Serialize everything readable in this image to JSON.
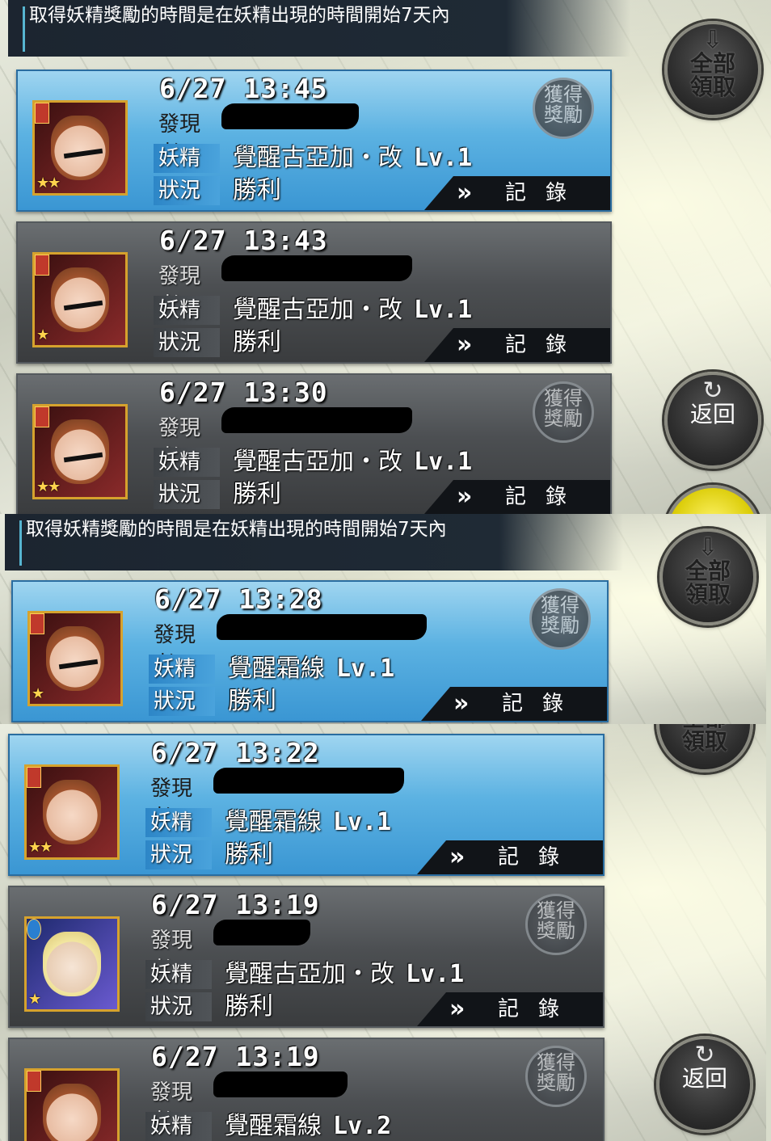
{
  "notice": "取得妖精獎勵的時間是在妖精出現的時間開始7天內",
  "buttons": {
    "claim_all": "全部\n領取",
    "claim_all_l1": "全部",
    "claim_all_l2": "領取",
    "back": "返回"
  },
  "labels": {
    "discoverer": "發現者",
    "fairy": "妖精",
    "status": "狀況",
    "reward_l1": "獲得",
    "reward_l2": "獎勵",
    "record": "記錄",
    "record_chevron": "»"
  },
  "cards": [
    {
      "time": "6/27 13:45",
      "fairy": "覺醒古亞加・改",
      "level": "Lv.1",
      "status": "勝利",
      "stars": "★★"
    },
    {
      "time": "6/27 13:43",
      "fairy": "覺醒古亞加・改",
      "level": "Lv.1",
      "status": "勝利",
      "stars": "★"
    },
    {
      "time": "6/27 13:30",
      "fairy": "覺醒古亞加・改",
      "level": "Lv.1",
      "status": "勝利",
      "stars": "★★"
    },
    {
      "time": "6/27 13:28",
      "fairy": "覺醒霜線",
      "level": "Lv.1",
      "status": "勝利",
      "stars": "★"
    },
    {
      "time": "6/27 13:22",
      "fairy": "覺醒霜線",
      "level": "Lv.1",
      "status": "勝利",
      "stars": "★★"
    },
    {
      "time": "6/27 13:19",
      "fairy": "覺醒古亞加・改",
      "level": "Lv.1",
      "status": "勝利",
      "stars": "★"
    },
    {
      "time": "6/27 13:19",
      "fairy": "覺醒霜線",
      "level": "Lv.2",
      "status": "",
      "stars": "★"
    }
  ]
}
